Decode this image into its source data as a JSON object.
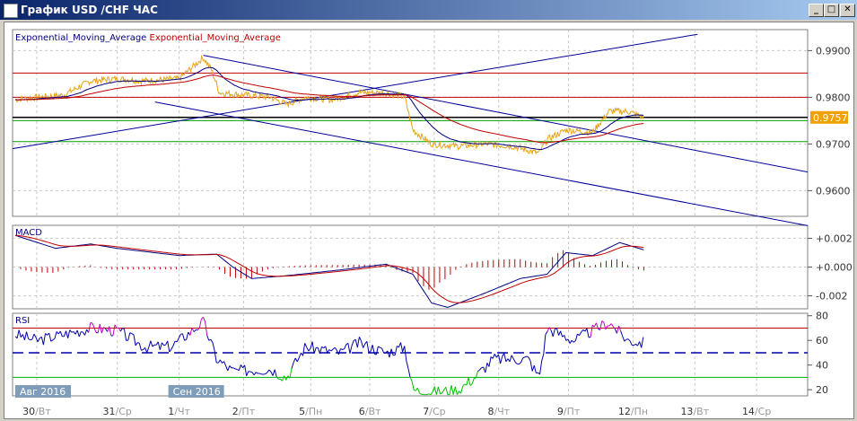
{
  "window": {
    "title": "График USD /CHF  ЧАС",
    "min": "_",
    "max": "□",
    "close": "✕"
  },
  "legend": [
    {
      "text": "Exponential_Moving_Average",
      "color": "#000080"
    },
    {
      "text": "Exponential_Moving_Average",
      "color": "#c00000"
    }
  ],
  "current_price": "0.9757",
  "panels": {
    "macd": "MACD",
    "rsi": "RSI"
  },
  "month_labels": [
    {
      "text": "Авг 2016",
      "x": 1
    },
    {
      "text": "Сен 2016",
      "x": 58
    }
  ],
  "chart_data": {
    "type": "line",
    "x_unit": "hours",
    "xlim": [
      0,
      296
    ],
    "x_ticks": [
      {
        "x": 9,
        "d": "30",
        "w": "Вт"
      },
      {
        "x": 39,
        "d": "31",
        "w": "Ср"
      },
      {
        "x": 62,
        "d": "1",
        "w": "Чт"
      },
      {
        "x": 86,
        "d": "2",
        "w": "Пт"
      },
      {
        "x": 111,
        "d": "5",
        "w": "Пн"
      },
      {
        "x": 133,
        "d": "6",
        "w": "Вт"
      },
      {
        "x": 157,
        "d": "7",
        "w": "Ср"
      },
      {
        "x": 181,
        "d": "8",
        "w": "Чт"
      },
      {
        "x": 207,
        "d": "9",
        "w": "Пт"
      },
      {
        "x": 231,
        "d": "12",
        "w": "Пн"
      },
      {
        "x": 254,
        "d": "13",
        "w": "Вт"
      },
      {
        "x": 277,
        "d": "14",
        "w": "Ср"
      }
    ],
    "price": {
      "ylim": [
        0.9545,
        0.9945
      ],
      "y_ticks": [
        "0.9900",
        "0.9800",
        "0.9700",
        "0.9600"
      ],
      "points": [
        [
          1,
          0.9795
        ],
        [
          9,
          0.98
        ],
        [
          19,
          0.9805
        ],
        [
          29,
          0.9835
        ],
        [
          39,
          0.984
        ],
        [
          49,
          0.9835
        ],
        [
          62,
          0.984
        ],
        [
          71,
          0.9885
        ],
        [
          74,
          0.986
        ],
        [
          77,
          0.981
        ],
        [
          86,
          0.9805
        ],
        [
          96,
          0.98
        ],
        [
          102,
          0.9785
        ],
        [
          109,
          0.98
        ],
        [
          119,
          0.9795
        ],
        [
          129,
          0.981
        ],
        [
          139,
          0.981
        ],
        [
          146,
          0.98
        ],
        [
          149,
          0.973
        ],
        [
          156,
          0.97
        ],
        [
          166,
          0.9695
        ],
        [
          176,
          0.97
        ],
        [
          186,
          0.9695
        ],
        [
          196,
          0.968
        ],
        [
          199,
          0.971
        ],
        [
          206,
          0.973
        ],
        [
          216,
          0.9725
        ],
        [
          222,
          0.977
        ],
        [
          229,
          0.977
        ],
        [
          235,
          0.9757
        ]
      ],
      "hlines": [
        {
          "y": 0.9852,
          "color": "#c00000"
        },
        {
          "y": 0.98,
          "color": "#c00000"
        },
        {
          "y": 0.975,
          "color": "#00a000"
        },
        {
          "y": 0.9705,
          "color": "#00a000"
        },
        {
          "y": 0.9757,
          "color": "#000000"
        }
      ],
      "trendlines": [
        [
          [
            0,
            0.969
          ],
          [
            255,
            0.9935
          ]
        ],
        [
          [
            71,
            0.989
          ],
          [
            296,
            0.964
          ]
        ],
        [
          [
            53,
            0.979
          ],
          [
            296,
            0.9525
          ]
        ]
      ]
    },
    "macd": {
      "ylim": [
        -0.0029,
        0.0029
      ],
      "y_ticks": [
        "+0.002",
        "+0.000",
        "-0.002"
      ],
      "points": [
        [
          1,
          0.0022
        ],
        [
          16,
          0.0013
        ],
        [
          29,
          0.0016
        ],
        [
          39,
          0.0013
        ],
        [
          62,
          0.0008
        ],
        [
          76,
          0.0009
        ],
        [
          82,
          0.0
        ],
        [
          89,
          -0.0008
        ],
        [
          102,
          -0.0006
        ],
        [
          122,
          -0.0002
        ],
        [
          139,
          0.0002
        ],
        [
          149,
          -0.0005
        ],
        [
          156,
          -0.0025
        ],
        [
          162,
          -0.0028
        ],
        [
          176,
          -0.0018
        ],
        [
          189,
          -0.0008
        ],
        [
          199,
          -0.0005
        ],
        [
          206,
          0.001
        ],
        [
          216,
          0.0008
        ],
        [
          226,
          0.0017
        ],
        [
          235,
          0.0012
        ]
      ]
    },
    "rsi": {
      "ylim": [
        15,
        82
      ],
      "y_ticks": [
        "80",
        "60",
        "40",
        "20"
      ],
      "levels": [
        70,
        50,
        30
      ],
      "points": [
        [
          1,
          65
        ],
        [
          9,
          60
        ],
        [
          19,
          65
        ],
        [
          29,
          70
        ],
        [
          39,
          68
        ],
        [
          49,
          55
        ],
        [
          59,
          55
        ],
        [
          71,
          75
        ],
        [
          76,
          45
        ],
        [
          82,
          35
        ],
        [
          96,
          37
        ],
        [
          102,
          30
        ],
        [
          109,
          55
        ],
        [
          122,
          50
        ],
        [
          129,
          58
        ],
        [
          139,
          50
        ],
        [
          146,
          55
        ],
        [
          149,
          20
        ],
        [
          156,
          18
        ],
        [
          166,
          20
        ],
        [
          172,
          30
        ],
        [
          179,
          45
        ],
        [
          192,
          45
        ],
        [
          196,
          30
        ],
        [
          199,
          70
        ],
        [
          209,
          60
        ],
        [
          222,
          75
        ],
        [
          229,
          60
        ],
        [
          235,
          58
        ]
      ]
    }
  }
}
